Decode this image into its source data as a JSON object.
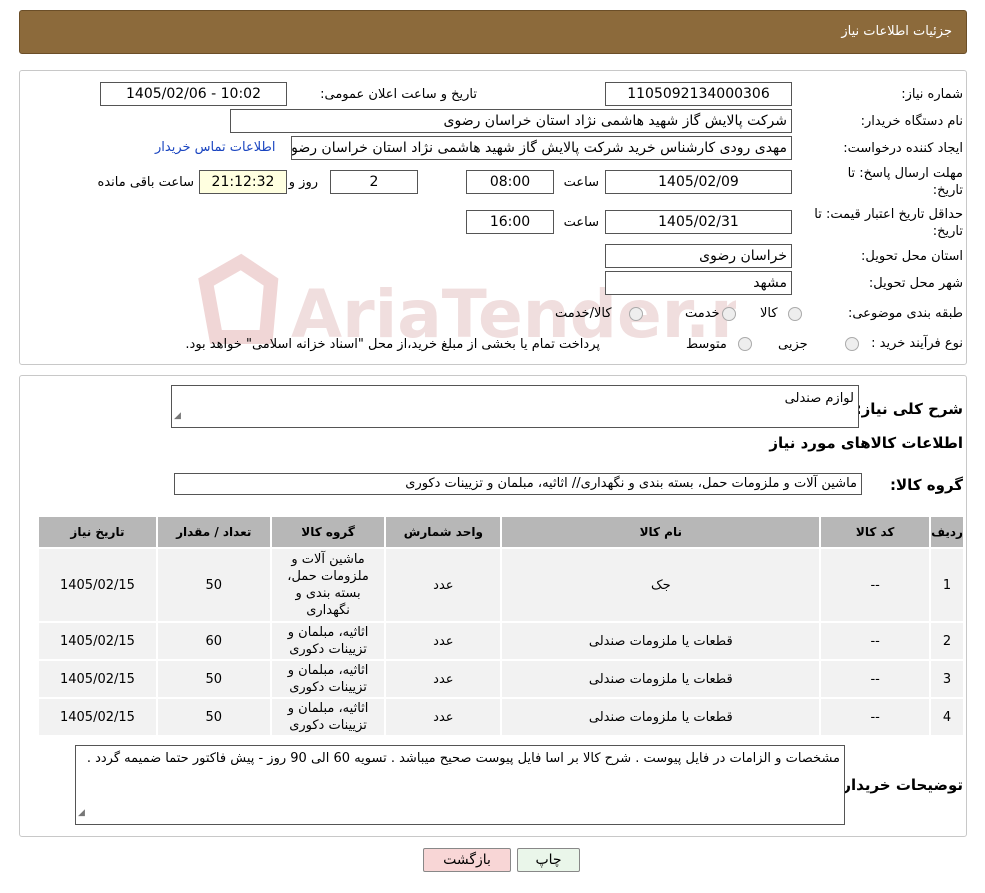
{
  "header": {
    "title": "جزئیات اطلاعات نیاز"
  },
  "form": {
    "need_number_label": "شماره نیاز:",
    "need_number": "1105092134000306",
    "announce_label": "تاریخ و ساعت اعلان عمومی:",
    "announce_value": "1405/02/06 - 10:02",
    "buyer_org_label": "نام دستگاه خریدار:",
    "buyer_org": "شرکت پالایش گاز شهید هاشمی نژاد   استان خراسان رضوی",
    "creator_label": "ایجاد کننده درخواست:",
    "creator": "مهدی رودی کارشناس خرید شرکت پالایش گاز شهید هاشمی نژاد   استان خراسان رضوی",
    "contact_link": "اطلاعات تماس خریدار",
    "deadline_label_1": "مهلت ارسال پاسخ: تا",
    "deadline_label_2": "تاریخ:",
    "deadline_date": "1405/02/09",
    "time_label": "ساعت",
    "deadline_time": "08:00",
    "days_value": "2",
    "days_label": "روز و",
    "remaining_time": "21:12:32",
    "remaining_label": "ساعت باقی مانده",
    "validity_label_1": "حداقل تاریخ اعتبار قیمت: تا",
    "validity_label_2": "تاریخ:",
    "validity_date": "1405/02/31",
    "validity_time_label": "ساعت",
    "validity_time": "16:00",
    "province_label": "استان محل تحویل:",
    "province": "خراسان رضوی",
    "city_label": "شهر محل تحویل:",
    "city": "مشهد",
    "category_label": "طبقه بندی موضوعی:",
    "category_options": [
      "کالا",
      "خدمت",
      "کالا/خدمت"
    ],
    "process_label": "نوع فرآیند خرید :",
    "process_options": [
      "جزیی",
      "متوسط"
    ],
    "process_note": "پرداخت تمام یا بخشی از مبلغ خرید،از محل \"اسناد خزانه اسلامی\" خواهد بود."
  },
  "details": {
    "summary_label": "شرح کلی نیاز:",
    "summary": "لوازم  صندلی",
    "goods_title": "اطلاعات کالاهای مورد نیاز",
    "group_label": "گروه کالا:",
    "group_value": "ماشین آلات و ملزومات حمل، بسته بندی و نگهداری// اثاثیه، مبلمان و تزیینات دکوری",
    "table": {
      "headers": [
        "ردیف",
        "کد کالا",
        "نام کالا",
        "واحد شمارش",
        "گروه کالا",
        "تعداد / مقدار",
        "تاریخ نیاز"
      ],
      "rows": [
        [
          "1",
          "--",
          "جک",
          "عدد",
          "ماشین آلات و ملزومات حمل، بسته بندی و نگهداری",
          "50",
          "1405/02/15"
        ],
        [
          "2",
          "--",
          "قطعات یا ملزومات صندلی",
          "عدد",
          "اثاثیه، مبلمان و تزیینات دکوری",
          "60",
          "1405/02/15"
        ],
        [
          "3",
          "--",
          "قطعات یا ملزومات صندلی",
          "عدد",
          "اثاثیه، مبلمان و تزیینات دکوری",
          "50",
          "1405/02/15"
        ],
        [
          "4",
          "--",
          "قطعات یا ملزومات صندلی",
          "عدد",
          "اثاثیه، مبلمان و تزیینات دکوری",
          "50",
          "1405/02/15"
        ]
      ]
    },
    "buyer_notes_label": "توضیحات خریدار:",
    "buyer_notes": "مشخصات و الزامات در فایل پیوست .    شرح کالا بر اسا فایل پیوست صحیح میباشد . تسویه 60 الی 90   روز  - پیش فاکتور حتما ضمیمه گردد ."
  },
  "buttons": {
    "print": "چاپ",
    "back": "بازگشت"
  },
  "watermark": {
    "text": "AriaTender.neT"
  },
  "colors": {
    "header_bg": "#8c6a3b",
    "table_header": "#b7b7b7",
    "back_button_bg": "#f8d6d6",
    "print_button_bg": "#eaf6ea",
    "remaining_bg": "#ffffe0"
  }
}
